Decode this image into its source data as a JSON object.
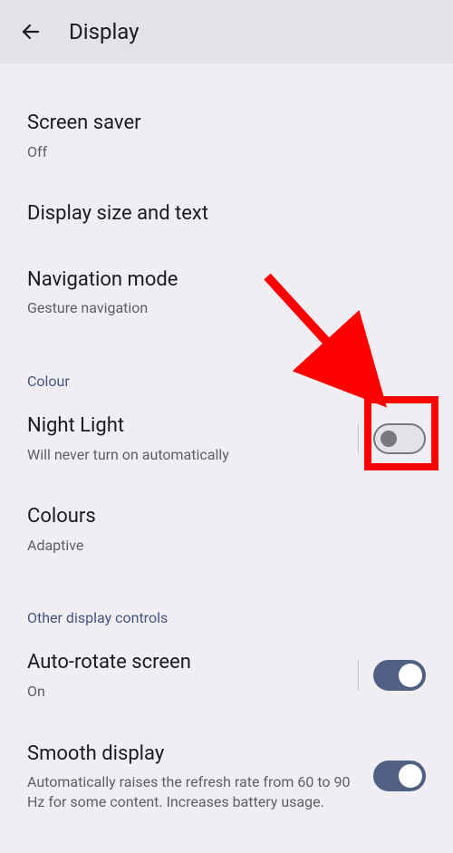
{
  "header": {
    "title": "Display"
  },
  "items": {
    "screen_saver": {
      "title": "Screen saver",
      "sub": "Off"
    },
    "display_size": {
      "title": "Display size and text"
    },
    "navigation_mode": {
      "title": "Navigation mode",
      "sub": "Gesture navigation"
    },
    "night_light": {
      "title": "Night Light",
      "sub": "Will never turn on automatically"
    },
    "colours": {
      "title": "Colours",
      "sub": "Adaptive"
    },
    "auto_rotate": {
      "title": "Auto-rotate screen",
      "sub": "On"
    },
    "smooth_display": {
      "title": "Smooth display",
      "sub": "Automatically raises the refresh rate from 60 to 90 Hz for some content. Increases battery usage."
    }
  },
  "sections": {
    "colour": "Colour",
    "other": "Other display controls"
  },
  "toggles": {
    "night_light": false,
    "auto_rotate": true,
    "smooth_display": true
  },
  "annotation": {
    "type": "highlight",
    "target": "night-light-toggle",
    "color": "#ff0000"
  }
}
